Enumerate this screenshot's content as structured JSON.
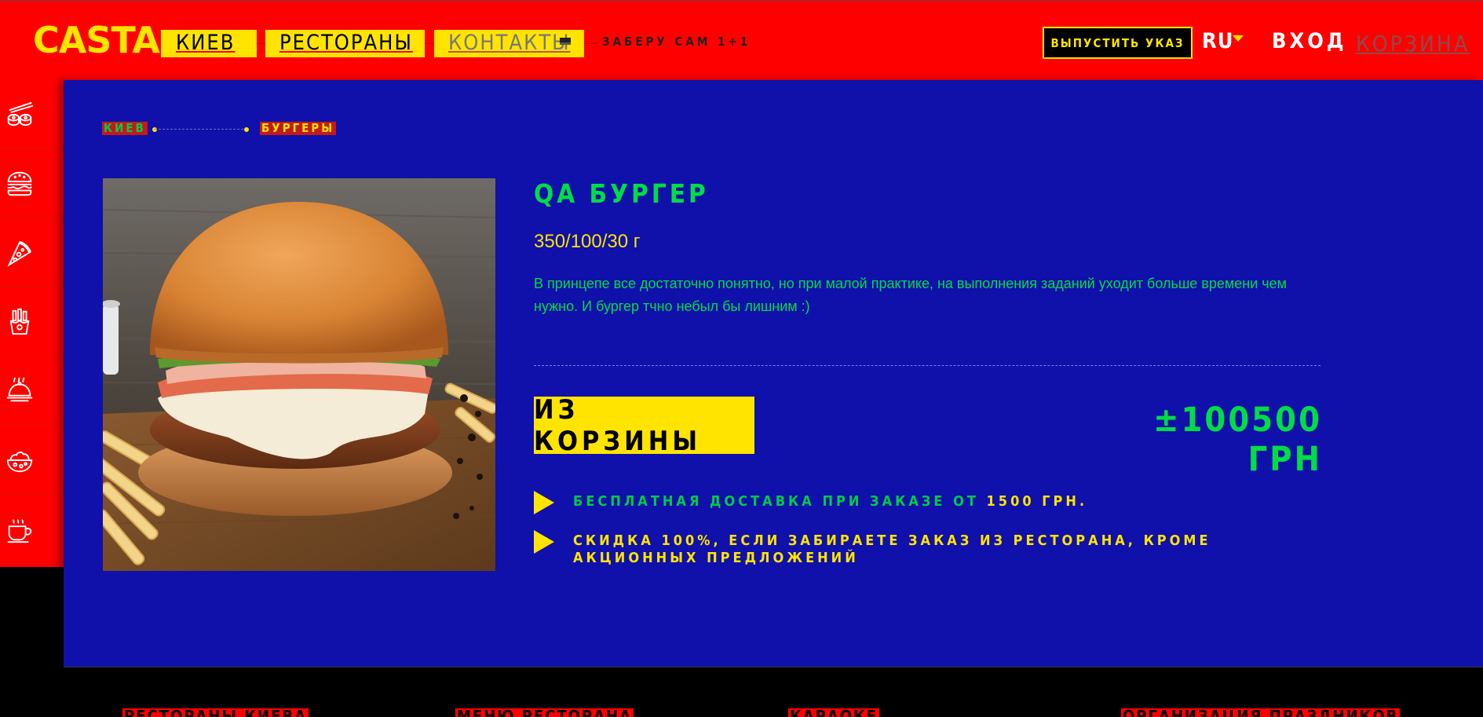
{
  "header": {
    "logo": "CASTA",
    "nav": [
      {
        "label": "Киев"
      },
      {
        "label": "Рестораны"
      },
      {
        "label": "Контакты"
      }
    ],
    "pickup_label": "Заберу сам 1+1",
    "decree_button": "Выпустить указ",
    "language": "RU",
    "login": "Вход",
    "cart": "Корзина"
  },
  "sidebar": {
    "icons": [
      "sushi-icon",
      "burger-icon",
      "pizza-icon",
      "fries-icon",
      "hot-dish-icon",
      "salad-icon",
      "coffee-cup-icon"
    ]
  },
  "breadcrumb": {
    "city": "Киев",
    "category": "Бургеры"
  },
  "product": {
    "title": "QA бургер",
    "weight": "350/100/30 г",
    "description": "В принцепе все достаточно понятно, но при малой практике, на выполнения заданий уходит больше времени чем нужно. И бургер тчно небыл бы лишним :)",
    "remove_button": "Из корзины",
    "price": "±100500 грн"
  },
  "perks": {
    "delivery_prefix": "Бесплатная доставка при заказе от",
    "delivery_amount": "1500 грн.",
    "discount": "Скидка 100%, если забираете заказ из ресторана, кроме акционных предложений"
  },
  "footer": {
    "links": [
      "Рестораны Киева",
      "Меню ресторана",
      "Караоке",
      "Организация праздников"
    ]
  },
  "colors": {
    "header_bg": "#ff0000",
    "main_bg": "#1010aa",
    "accent_yellow": "#ffe400",
    "accent_green": "#00dd44"
  }
}
